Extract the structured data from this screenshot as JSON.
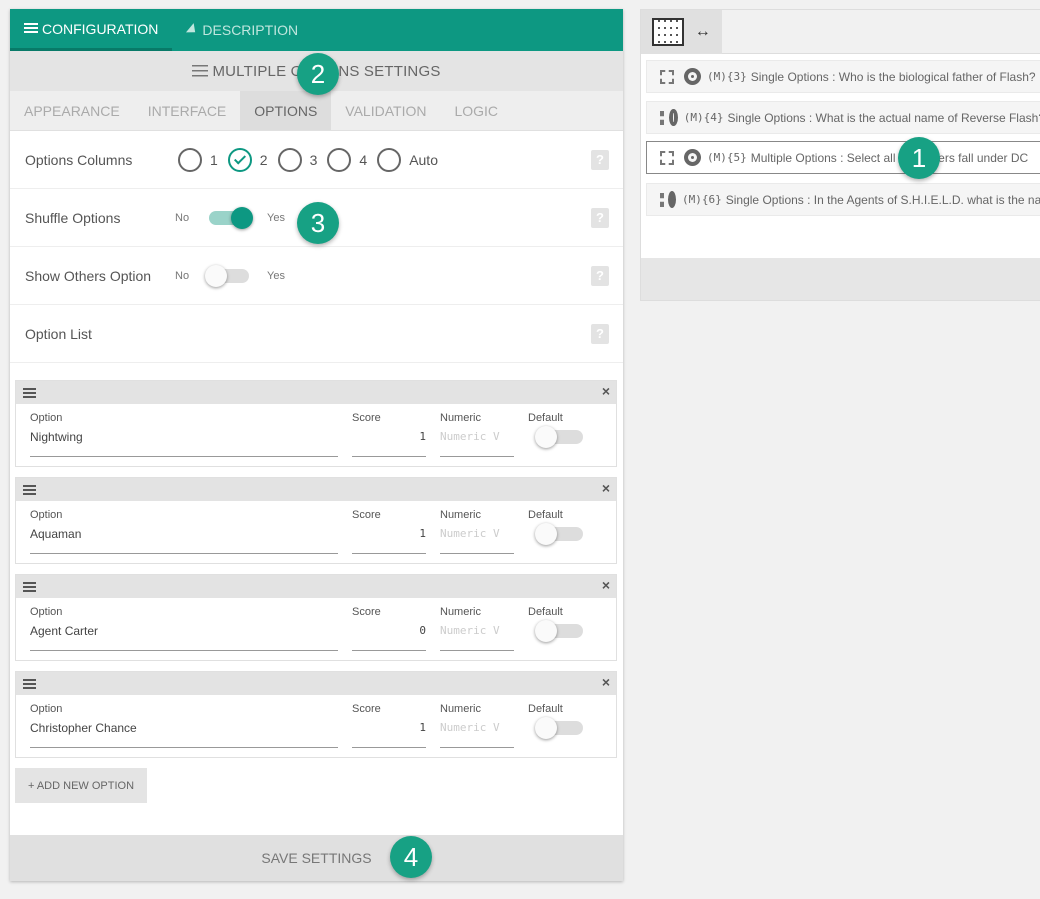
{
  "top_tabs": {
    "configuration": "CONFIGURATION",
    "description": "DESCRIPTION"
  },
  "panel_title": "MULTIPLE OPTIONS SETTINGS",
  "sub_tabs": [
    "APPEARANCE",
    "INTERFACE",
    "OPTIONS",
    "VALIDATION",
    "LOGIC"
  ],
  "active_sub_tab": "OPTIONS",
  "settings": {
    "options_columns": {
      "label": "Options Columns",
      "choices": [
        "1",
        "2",
        "3",
        "4",
        "Auto"
      ],
      "selected": "2"
    },
    "shuffle": {
      "label": "Shuffle Options",
      "no": "No",
      "yes": "Yes",
      "on": true
    },
    "others": {
      "label": "Show Others Option",
      "no": "No",
      "yes": "Yes",
      "on": false
    },
    "option_list": {
      "label": "Option List"
    },
    "help": "?"
  },
  "option_columns": {
    "option": "Option",
    "score": "Score",
    "numeric": "Numeric",
    "default": "Default",
    "numeric_placeholder": "Numeric V"
  },
  "options": [
    {
      "name": "Nightwing",
      "score": "1",
      "default": false
    },
    {
      "name": "Aquaman",
      "score": "1",
      "default": false
    },
    {
      "name": "Agent Carter",
      "score": "0",
      "default": false
    },
    {
      "name": "Christopher Chance",
      "score": "1",
      "default": false
    }
  ],
  "add_option": "+ ADD NEW OPTION",
  "save_settings": "SAVE SETTINGS",
  "remove_icon": "×",
  "arrows": "↔",
  "questions": [
    {
      "code": "(M){3}",
      "text": "Single Options : Who is the biological father of Flash?"
    },
    {
      "code": "(M){4}",
      "text": "Single Options : What is the actual name of Reverse Flash?"
    },
    {
      "code": "(M){5}",
      "text": "Multiple Options : Select all characters fall under DC",
      "selected": true
    },
    {
      "code": "(M){6}",
      "text": "Single Options : In the Agents of S.H.I.E.L.D. what is the name?"
    }
  ],
  "badges": [
    "1",
    "2",
    "3",
    "4"
  ],
  "colors": {
    "accent": "#0d9882",
    "badge": "#17a184"
  }
}
